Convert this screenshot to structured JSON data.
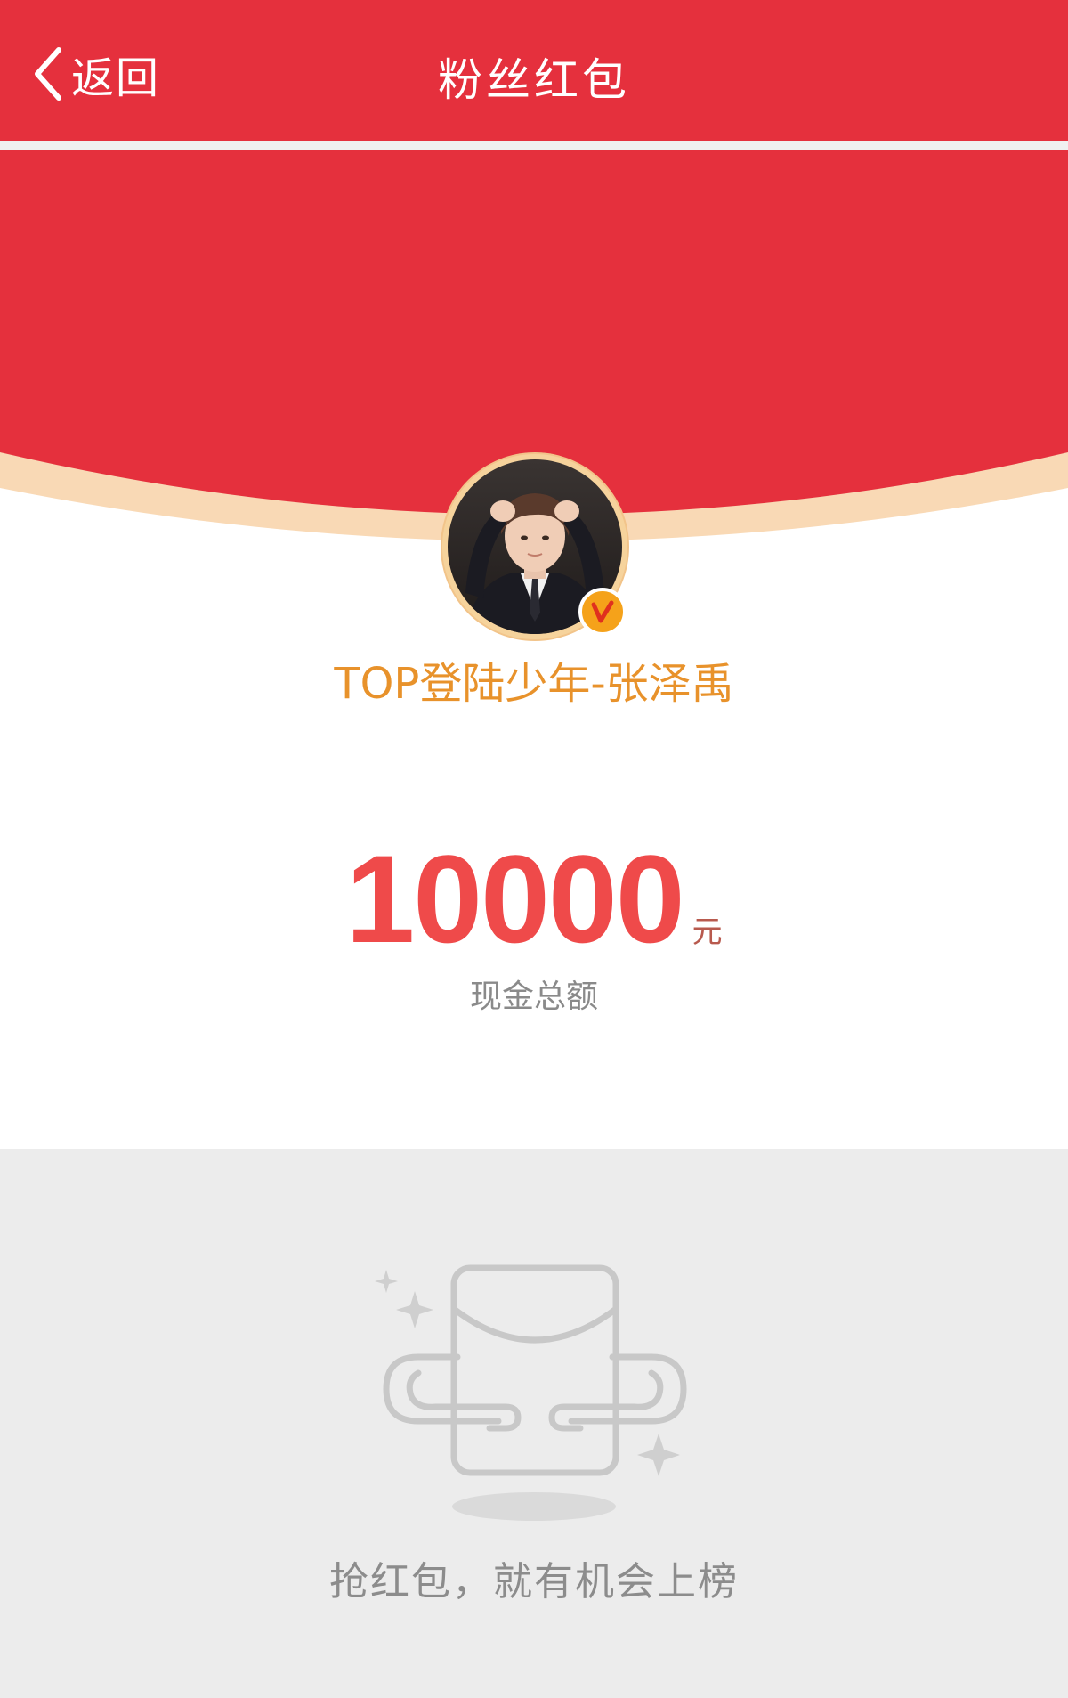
{
  "theme": {
    "primary": "#e5303d",
    "accent": "#e8922b",
    "amount": "#ef4a4a",
    "avatar_ring": "#f6d39c",
    "badge": "#f5a21a",
    "curve_edge": "#f9d9b5"
  },
  "nav": {
    "back_label": "返回",
    "title": "粉丝红包",
    "back_icon": "chevron-left-icon"
  },
  "profile": {
    "name": "TOP登陆少年-张泽禹",
    "avatar_icon": "user-avatar",
    "badge_icon": "vip-badge-icon"
  },
  "redpacket": {
    "amount": "10000",
    "unit": "元",
    "caption": "现金总额"
  },
  "empty_state": {
    "illustration_icon": "empty-red-packet-icon",
    "message": "抢红包，就有机会上榜"
  }
}
